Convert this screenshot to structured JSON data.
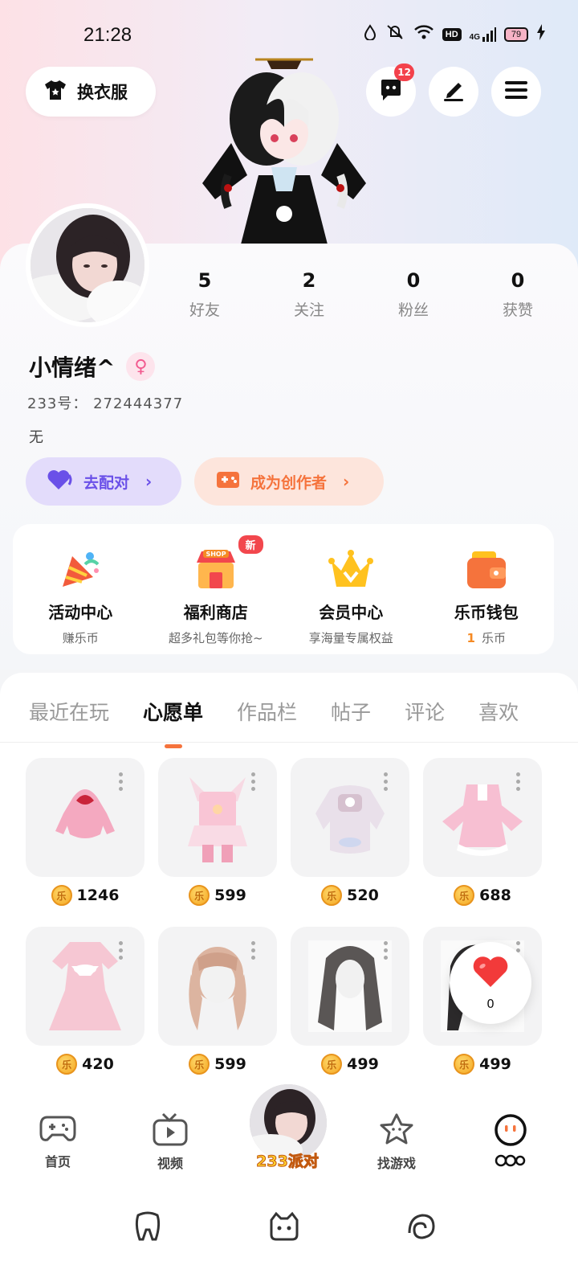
{
  "status_bar": {
    "time": "21:28",
    "network": "4G",
    "hd": "HD",
    "battery": "79"
  },
  "header": {
    "outfit_label": "换衣服",
    "message_badge": "12"
  },
  "profile": {
    "stats": [
      {
        "value": "5",
        "label": "好友"
      },
      {
        "value": "2",
        "label": "关注"
      },
      {
        "value": "0",
        "label": "粉丝"
      },
      {
        "value": "0",
        "label": "获赞"
      }
    ],
    "username": "小情绪^",
    "gender_symbol": "♀",
    "uid": "233号：  272444377",
    "bio": "无",
    "match_label": "去配对",
    "creator_label": "成为创作者"
  },
  "services": [
    {
      "title": "活动中心",
      "subtitle": "赚乐币",
      "icon": "party-popper-icon"
    },
    {
      "title": "福利商店",
      "subtitle": "超多礼包等你抢~",
      "icon": "shop-icon",
      "tag": "新"
    },
    {
      "title": "会员中心",
      "subtitle": "享海量专属权益",
      "icon": "crown-icon"
    },
    {
      "title": "乐币钱包",
      "subtitle_count": "1",
      "subtitle": "乐币",
      "icon": "wallet-icon"
    }
  ],
  "tabs": [
    "最近在玩",
    "心愿单",
    "作品栏",
    "帖子",
    "评论",
    "喜欢"
  ],
  "active_tab": "心愿单",
  "wishlist": [
    {
      "price": "1246",
      "item": "pink bunny hoodie"
    },
    {
      "price": "599",
      "item": "pink idol outfit"
    },
    {
      "price": "520",
      "item": "bear sweater dress"
    },
    {
      "price": "688",
      "item": "pink frilly dress"
    },
    {
      "price": "420",
      "item": "pink bow dress"
    },
    {
      "price": "599",
      "item": "twin tail hair"
    },
    {
      "price": "499",
      "item": "long wavy hair"
    },
    {
      "price": "499",
      "item": "long hair"
    }
  ],
  "like_bubble": {
    "count": "0"
  },
  "bottom_nav": [
    {
      "label": "首页",
      "icon": "gamepad-icon"
    },
    {
      "label": "视频",
      "icon": "tv-icon"
    },
    {
      "label": "233派对",
      "icon": "party-avatar"
    },
    {
      "label": "找游戏",
      "icon": "star-icon"
    },
    {
      "label": "",
      "icon": "profile-face-icon"
    }
  ],
  "colors": {
    "accent": "#f5733c",
    "purple": "#6a50e8",
    "badge": "#f3414b"
  }
}
